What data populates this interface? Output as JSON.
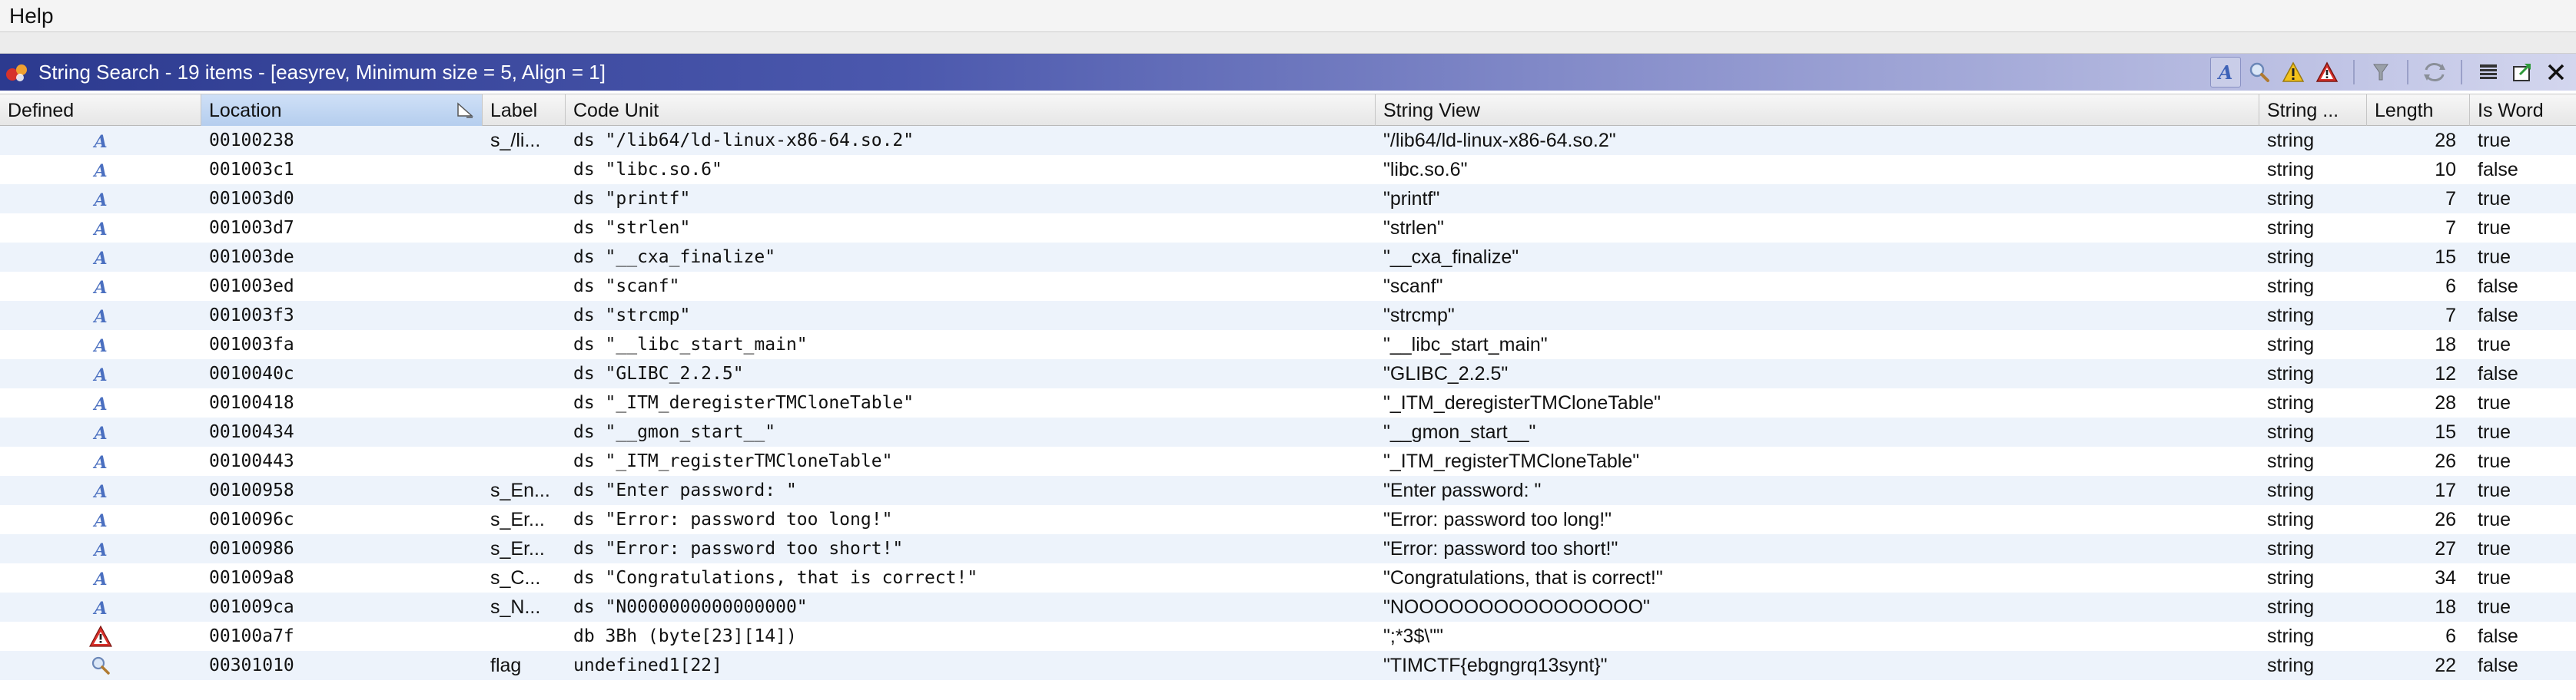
{
  "menubar": {
    "help": "Help"
  },
  "window": {
    "title": "String Search - 19 items - [easyrev, Minimum size = 5, Align = 1]"
  },
  "columns": {
    "defined": "Defined",
    "location": "Location",
    "label": "Label",
    "code_unit": "Code Unit",
    "string_view": "String View",
    "string_type": "String ...",
    "length": "Length",
    "is_word": "Is Word"
  },
  "rows": [
    {
      "icon": "defined-string-icon",
      "location": "00100238",
      "label": "s_/li...",
      "code_unit": "ds \"/lib64/ld-linux-x86-64.so.2\"",
      "string_view": "\"/lib64/ld-linux-x86-64.so.2\"",
      "type": "string",
      "length": "28",
      "is_word": "true"
    },
    {
      "icon": "defined-string-icon",
      "location": "001003c1",
      "label": "",
      "code_unit": "ds \"libc.so.6\"",
      "string_view": "\"libc.so.6\"",
      "type": "string",
      "length": "10",
      "is_word": "false"
    },
    {
      "icon": "defined-string-icon",
      "location": "001003d0",
      "label": "",
      "code_unit": "ds \"printf\"",
      "string_view": "\"printf\"",
      "type": "string",
      "length": "7",
      "is_word": "true"
    },
    {
      "icon": "defined-string-icon",
      "location": "001003d7",
      "label": "",
      "code_unit": "ds \"strlen\"",
      "string_view": "\"strlen\"",
      "type": "string",
      "length": "7",
      "is_word": "true"
    },
    {
      "icon": "defined-string-icon",
      "location": "001003de",
      "label": "",
      "code_unit": "ds \"__cxa_finalize\"",
      "string_view": "\"__cxa_finalize\"",
      "type": "string",
      "length": "15",
      "is_word": "true"
    },
    {
      "icon": "defined-string-icon",
      "location": "001003ed",
      "label": "",
      "code_unit": "ds \"scanf\"",
      "string_view": "\"scanf\"",
      "type": "string",
      "length": "6",
      "is_word": "false"
    },
    {
      "icon": "defined-string-icon",
      "location": "001003f3",
      "label": "",
      "code_unit": "ds \"strcmp\"",
      "string_view": "\"strcmp\"",
      "type": "string",
      "length": "7",
      "is_word": "false"
    },
    {
      "icon": "defined-string-icon",
      "location": "001003fa",
      "label": "",
      "code_unit": "ds \"__libc_start_main\"",
      "string_view": "\"__libc_start_main\"",
      "type": "string",
      "length": "18",
      "is_word": "true"
    },
    {
      "icon": "defined-string-icon",
      "location": "0010040c",
      "label": "",
      "code_unit": "ds \"GLIBC_2.2.5\"",
      "string_view": "\"GLIBC_2.2.5\"",
      "type": "string",
      "length": "12",
      "is_word": "false"
    },
    {
      "icon": "defined-string-icon",
      "location": "00100418",
      "label": "",
      "code_unit": "ds \"_ITM_deregisterTMCloneTable\"",
      "string_view": "\"_ITM_deregisterTMCloneTable\"",
      "type": "string",
      "length": "28",
      "is_word": "true"
    },
    {
      "icon": "defined-string-icon",
      "location": "00100434",
      "label": "",
      "code_unit": "ds \"__gmon_start__\"",
      "string_view": "\"__gmon_start__\"",
      "type": "string",
      "length": "15",
      "is_word": "true"
    },
    {
      "icon": "defined-string-icon",
      "location": "00100443",
      "label": "",
      "code_unit": "ds \"_ITM_registerTMCloneTable\"",
      "string_view": "\"_ITM_registerTMCloneTable\"",
      "type": "string",
      "length": "26",
      "is_word": "true"
    },
    {
      "icon": "defined-string-icon",
      "location": "00100958",
      "label": "s_En...",
      "code_unit": "ds \"Enter password: \"",
      "string_view": "\"Enter password: \"",
      "type": "string",
      "length": "17",
      "is_word": "true"
    },
    {
      "icon": "defined-string-icon",
      "location": "0010096c",
      "label": "s_Er...",
      "code_unit": "ds \"Error: password too long!\"",
      "string_view": "\"Error: password too long!\"",
      "type": "string",
      "length": "26",
      "is_word": "true"
    },
    {
      "icon": "defined-string-icon",
      "location": "00100986",
      "label": "s_Er...",
      "code_unit": "ds \"Error: password too short!\"",
      "string_view": "\"Error: password too short!\"",
      "type": "string",
      "length": "27",
      "is_word": "true"
    },
    {
      "icon": "defined-string-icon",
      "location": "001009a8",
      "label": "s_C...",
      "code_unit": "ds \"Congratulations, that is correct!\"",
      "string_view": "\"Congratulations, that is correct!\"",
      "type": "string",
      "length": "34",
      "is_word": "true"
    },
    {
      "icon": "defined-string-icon",
      "location": "001009ca",
      "label": "s_N...",
      "code_unit": "ds \"N0000000000000000\"",
      "string_view": "\"NOOOOOOOOOOOOOOOO\"",
      "type": "string",
      "length": "18",
      "is_word": "true"
    },
    {
      "icon": "conflict-warning-icon",
      "location": "00100a7f",
      "label": "",
      "code_unit": "db 3Bh (byte[23][14])",
      "string_view": "\";*3$\\\"\"",
      "type": "string",
      "length": "6",
      "is_word": "false"
    },
    {
      "icon": "undefined-string-icon",
      "location": "00301010",
      "label": "flag",
      "code_unit": "undefined1[22]",
      "string_view": "\"TIMCTF{ebgngrq13synt}\"",
      "type": "string",
      "length": "22",
      "is_word": "false"
    }
  ],
  "colors": {
    "titlebar_start": "#2c3a8f",
    "row_alt": "#edf3fb",
    "icon_blue": "#4a6fc0",
    "warning_red": "#c0392b"
  }
}
